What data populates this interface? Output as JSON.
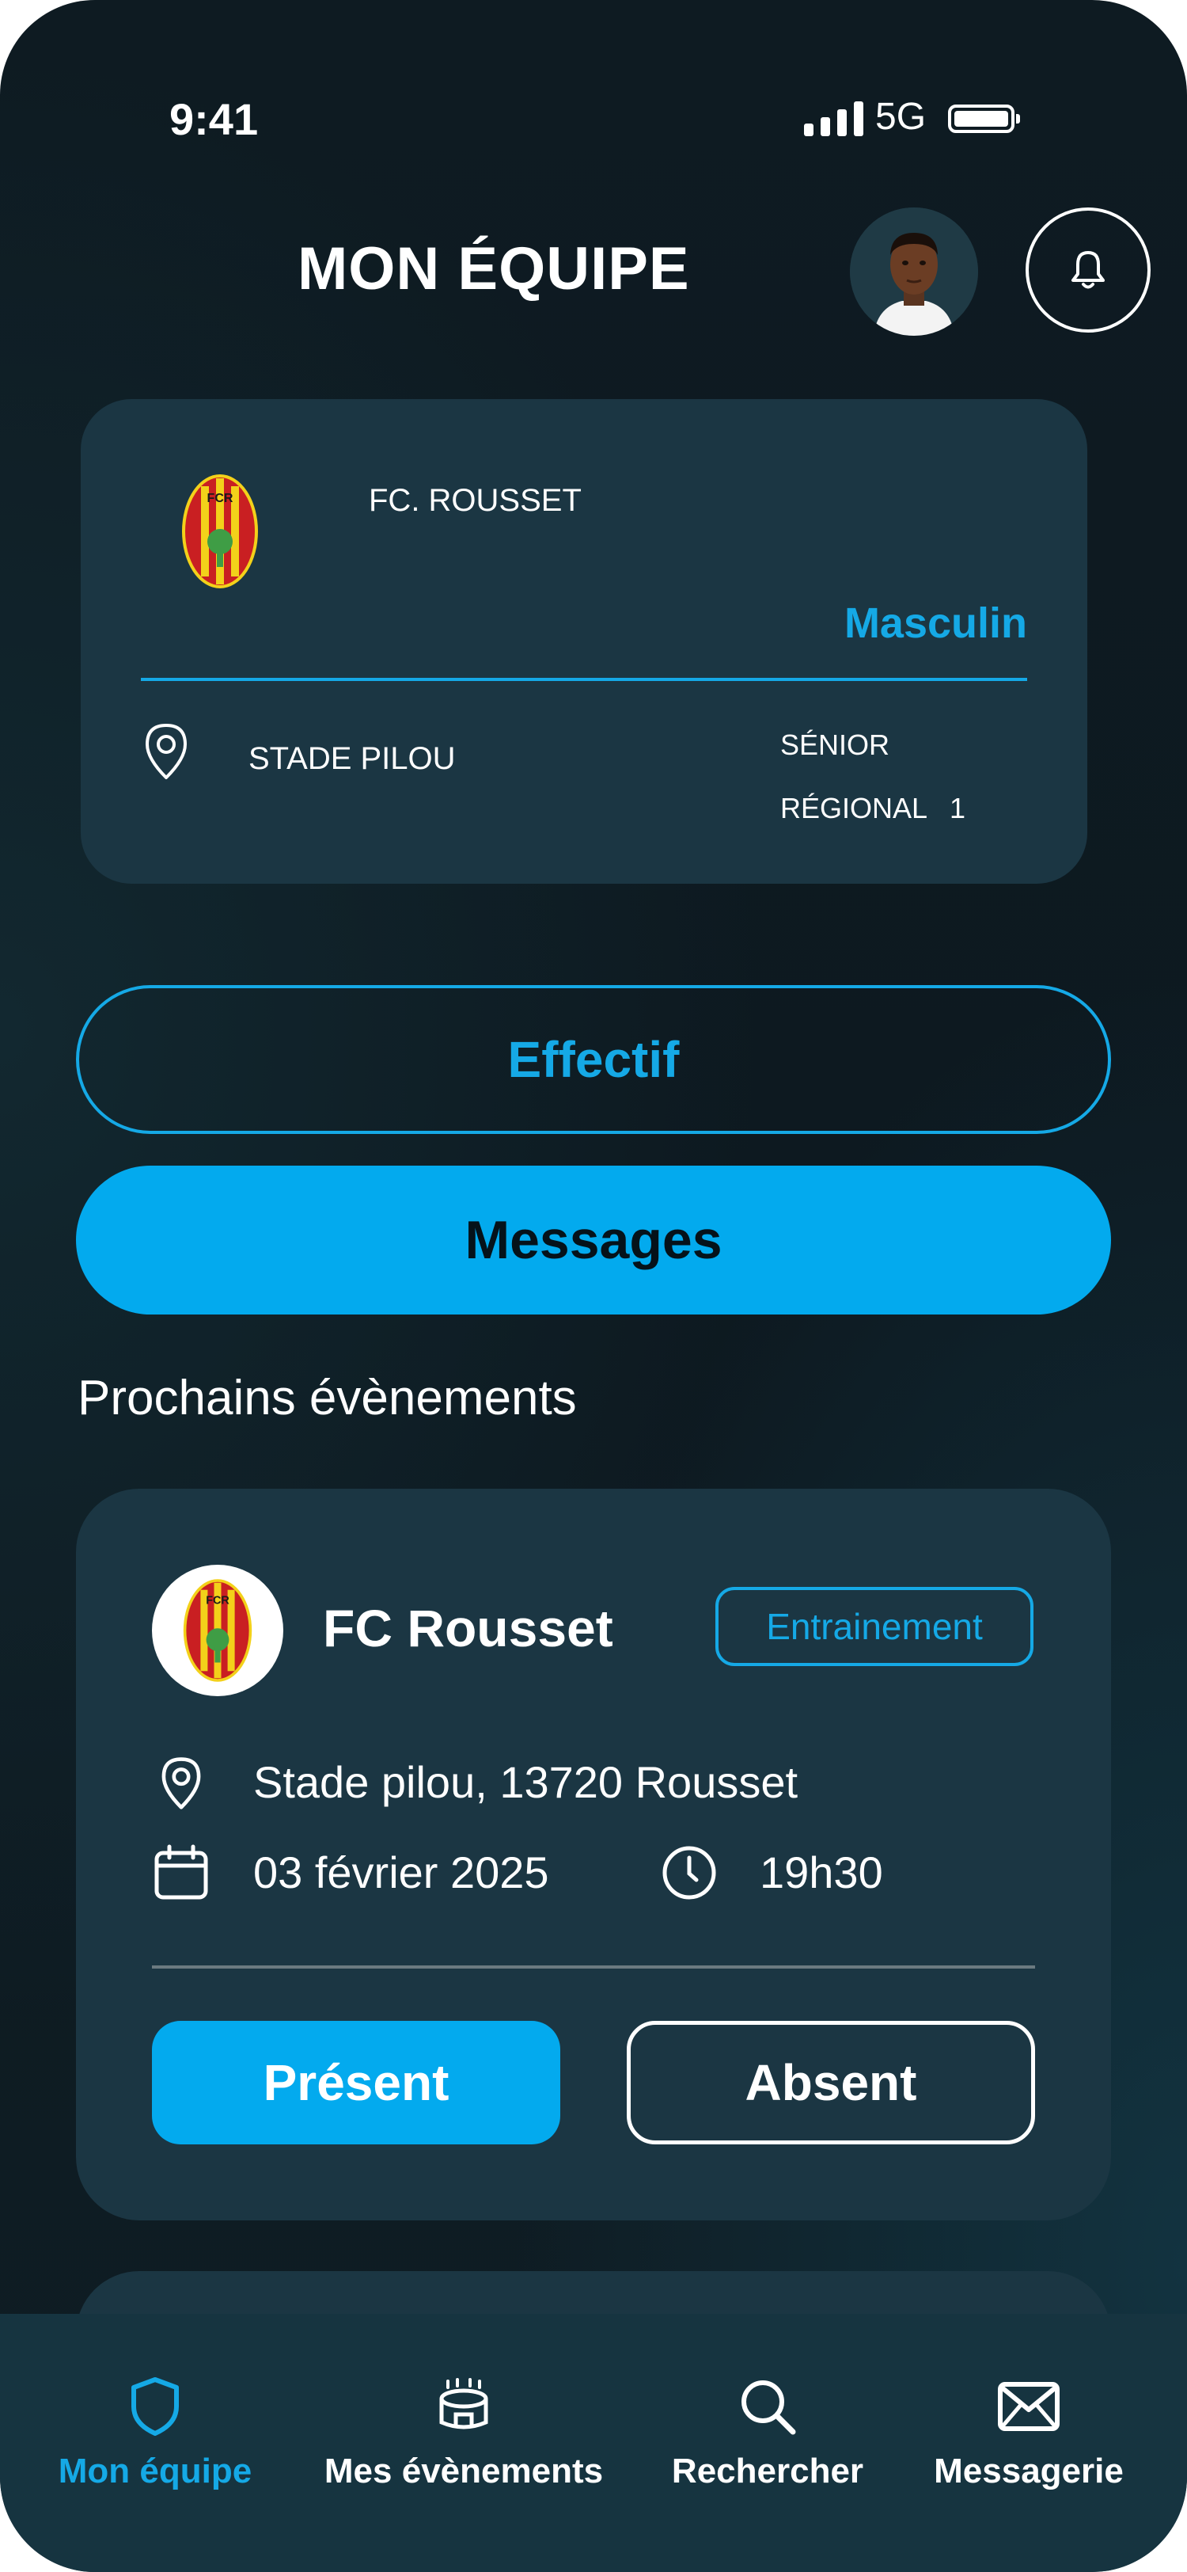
{
  "status_bar": {
    "time": "9:41",
    "network": "5G"
  },
  "header": {
    "title": "MON ÉQUIPE"
  },
  "team": {
    "name": "FC. ROUSSET",
    "gender": "Masculin",
    "stadium": "STADE PILOU",
    "category": "SÉNIOR",
    "division": "RÉGIONAL",
    "division_level": "1",
    "logo_letters": "FCR"
  },
  "actions": {
    "effectif": "Effectif",
    "messages": "Messages"
  },
  "events_section": {
    "title": "Prochains évènements"
  },
  "event": {
    "team": "FC Rousset",
    "type": "Entrainement",
    "location": "Stade pilou, 13720 Rousset",
    "date": "03 février 2025",
    "time": "19h30",
    "present_label": "Présent",
    "absent_label": "Absent"
  },
  "tabs": [
    {
      "label": "Mon équipe",
      "icon": "shield-icon",
      "active": true
    },
    {
      "label": "Mes évènements",
      "icon": "stadium-icon",
      "active": false
    },
    {
      "label": "Rechercher",
      "icon": "search-icon",
      "active": false
    },
    {
      "label": "Messagerie",
      "icon": "envelope-icon",
      "active": false
    }
  ],
  "colors": {
    "accent": "#15a9e6",
    "button": "#03aaee",
    "card": "#1b3643",
    "background": "#0e1b22"
  }
}
